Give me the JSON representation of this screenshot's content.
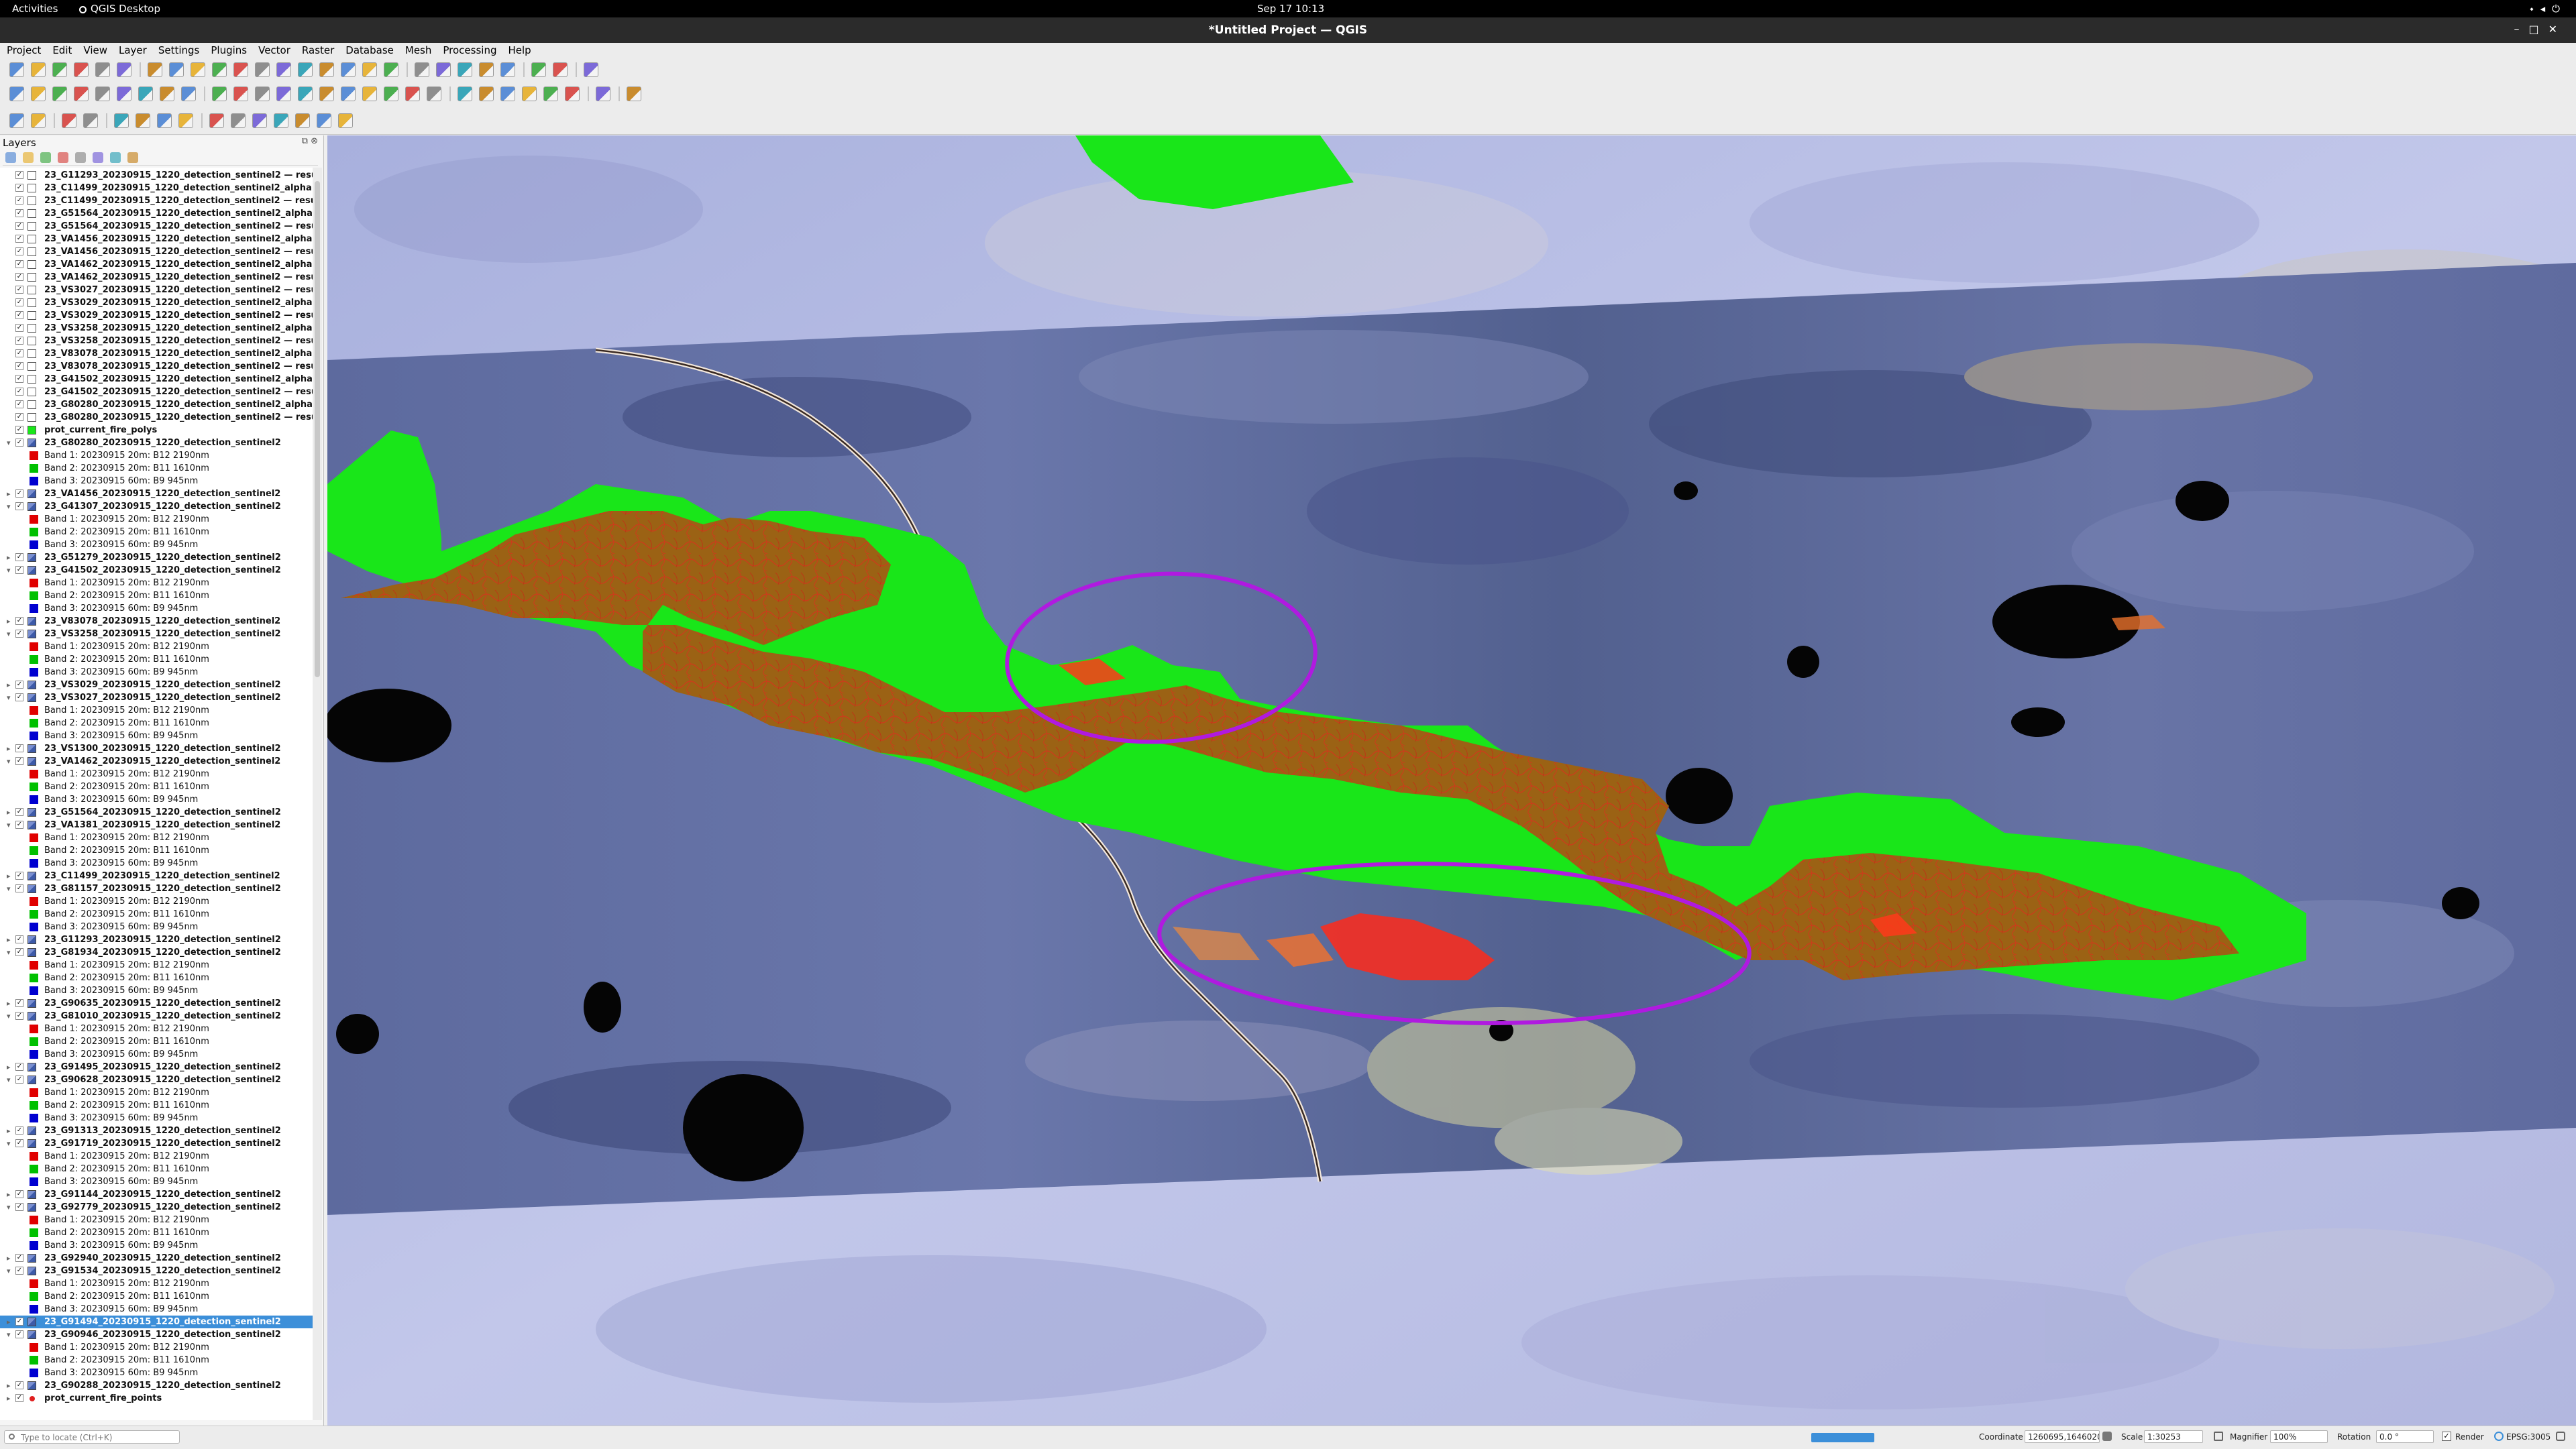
{
  "system": {
    "activities": "Activities",
    "app_name": "QGIS Desktop",
    "clock": "Sep 17  10:13"
  },
  "window": {
    "title": "*Untitled Project — QGIS"
  },
  "menu": [
    "Project",
    "Edit",
    "View",
    "Layer",
    "Settings",
    "Plugins",
    "Vector",
    "Raster",
    "Database",
    "Mesh",
    "Processing",
    "Help"
  ],
  "layers_panel": {
    "title": "Layers",
    "vector_layers": [
      "23_G11293_20230915_1220_detection_sentinel2 — resu",
      "23_C11499_20230915_1220_detection_sentinel2_alpha",
      "23_C11499_20230915_1220_detection_sentinel2 — resu",
      "23_G51564_20230915_1220_detection_sentinel2_alpha",
      "23_G51564_20230915_1220_detection_sentinel2 — resu",
      "23_VA1456_20230915_1220_detection_sentinel2_alpha",
      "23_VA1456_20230915_1220_detection_sentinel2 — resu",
      "23_VA1462_20230915_1220_detection_sentinel2_alpha",
      "23_VA1462_20230915_1220_detection_sentinel2 — resu",
      "23_VS3027_20230915_1220_detection_sentinel2 — resu",
      "23_VS3029_20230915_1220_detection_sentinel2_alpha",
      "23_VS3029_20230915_1220_detection_sentinel2 — resu",
      "23_VS3258_20230915_1220_detection_sentinel2_alpha",
      "23_VS3258_20230915_1220_detection_sentinel2 — resu",
      "23_V83078_20230915_1220_detection_sentinel2_alpha",
      "23_V83078_20230915_1220_detection_sentinel2 — resu",
      "23_G41502_20230915_1220_detection_sentinel2_alpha",
      "23_G41502_20230915_1220_detection_sentinel2 — resu",
      "23_G80280_20230915_1220_detection_sentinel2_alpha",
      "23_G80280_20230915_1220_detection_sentinel2 — resu",
      "prot_current_fire_polys"
    ],
    "band_labels": [
      "Band 1: 20230915 20m: B12 2190nm",
      "Band 2: 20230915 20m: B11 1610nm",
      "Band 3: 20230915 60m: B9 945nm"
    ],
    "band_colors": [
      "#e00000",
      "#00c000",
      "#0000d0"
    ],
    "raster_groups": [
      {
        "name": "23_G80280_20230915_1220_detection_sentinel2",
        "expanded": true
      },
      {
        "name": "23_VA1456_20230915_1220_detection_sentinel2",
        "expanded": false
      },
      {
        "name": "23_G41307_20230915_1220_detection_sentinel2",
        "expanded": true
      },
      {
        "name": "23_G51279_20230915_1220_detection_sentinel2",
        "expanded": false
      },
      {
        "name": "23_G41502_20230915_1220_detection_sentinel2",
        "expanded": true
      },
      {
        "name": "23_V83078_20230915_1220_detection_sentinel2",
        "expanded": false
      },
      {
        "name": "23_VS3258_20230915_1220_detection_sentinel2",
        "expanded": true
      },
      {
        "name": "23_VS3029_20230915_1220_detection_sentinel2",
        "expanded": false
      },
      {
        "name": "23_VS3027_20230915_1220_detection_sentinel2",
        "expanded": true
      },
      {
        "name": "23_VS1300_20230915_1220_detection_sentinel2",
        "expanded": false
      },
      {
        "name": "23_VA1462_20230915_1220_detection_sentinel2",
        "expanded": true
      },
      {
        "name": "23_G51564_20230915_1220_detection_sentinel2",
        "expanded": false
      },
      {
        "name": "23_VA1381_20230915_1220_detection_sentinel2",
        "expanded": true
      },
      {
        "name": "23_C11499_20230915_1220_detection_sentinel2",
        "expanded": false
      },
      {
        "name": "23_G81157_20230915_1220_detection_sentinel2",
        "expanded": true
      },
      {
        "name": "23_G11293_20230915_1220_detection_sentinel2",
        "expanded": false
      },
      {
        "name": "23_G81934_20230915_1220_detection_sentinel2",
        "expanded": true
      },
      {
        "name": "23_G90635_20230915_1220_detection_sentinel2",
        "expanded": false
      },
      {
        "name": "23_G81010_20230915_1220_detection_sentinel2",
        "expanded": true
      },
      {
        "name": "23_G91495_20230915_1220_detection_sentinel2",
        "expanded": false
      },
      {
        "name": "23_G90628_20230915_1220_detection_sentinel2",
        "expanded": true
      },
      {
        "name": "23_G91313_20230915_1220_detection_sentinel2",
        "expanded": false
      },
      {
        "name": "23_G91719_20230915_1220_detection_sentinel2",
        "expanded": true
      },
      {
        "name": "23_G91144_20230915_1220_detection_sentinel2",
        "expanded": false
      },
      {
        "name": "23_G92779_20230915_1220_detection_sentinel2",
        "expanded": true
      },
      {
        "name": "23_G92940_20230915_1220_detection_sentinel2",
        "expanded": false
      },
      {
        "name": "23_G91534_20230915_1220_detection_sentinel2",
        "expanded": true
      },
      {
        "name": "23_G91494_20230915_1220_detection_sentinel2",
        "expanded": false,
        "selected": true
      },
      {
        "name": "23_G90946_20230915_1220_detection_sentinel2",
        "expanded": true
      },
      {
        "name": "23_G90288_20230915_1220_detection_sentinel2",
        "expanded": false
      }
    ],
    "point_layer": "prot_current_fire_points"
  },
  "statusbar": {
    "locator_placeholder": "Type to locate (Ctrl+K)",
    "coordinate_label": "Coordinate",
    "coordinate_value": "1260695,1646020",
    "scale_label": "Scale",
    "scale_value": "1:30253",
    "magnifier_label": "Magnifier",
    "magnifier_value": "100%",
    "rotation_label": "Rotation",
    "rotation_value": "0.0 °",
    "render_label": "Render",
    "crs": "EPSG:3005"
  },
  "colors": {
    "fire_polygon_fill": "#9b6214",
    "buffer_fill": "#19e619",
    "annotation_ellipse": "#b01ae0",
    "hotspot": "#ff2a1a",
    "selection": "#3c8fd9"
  }
}
